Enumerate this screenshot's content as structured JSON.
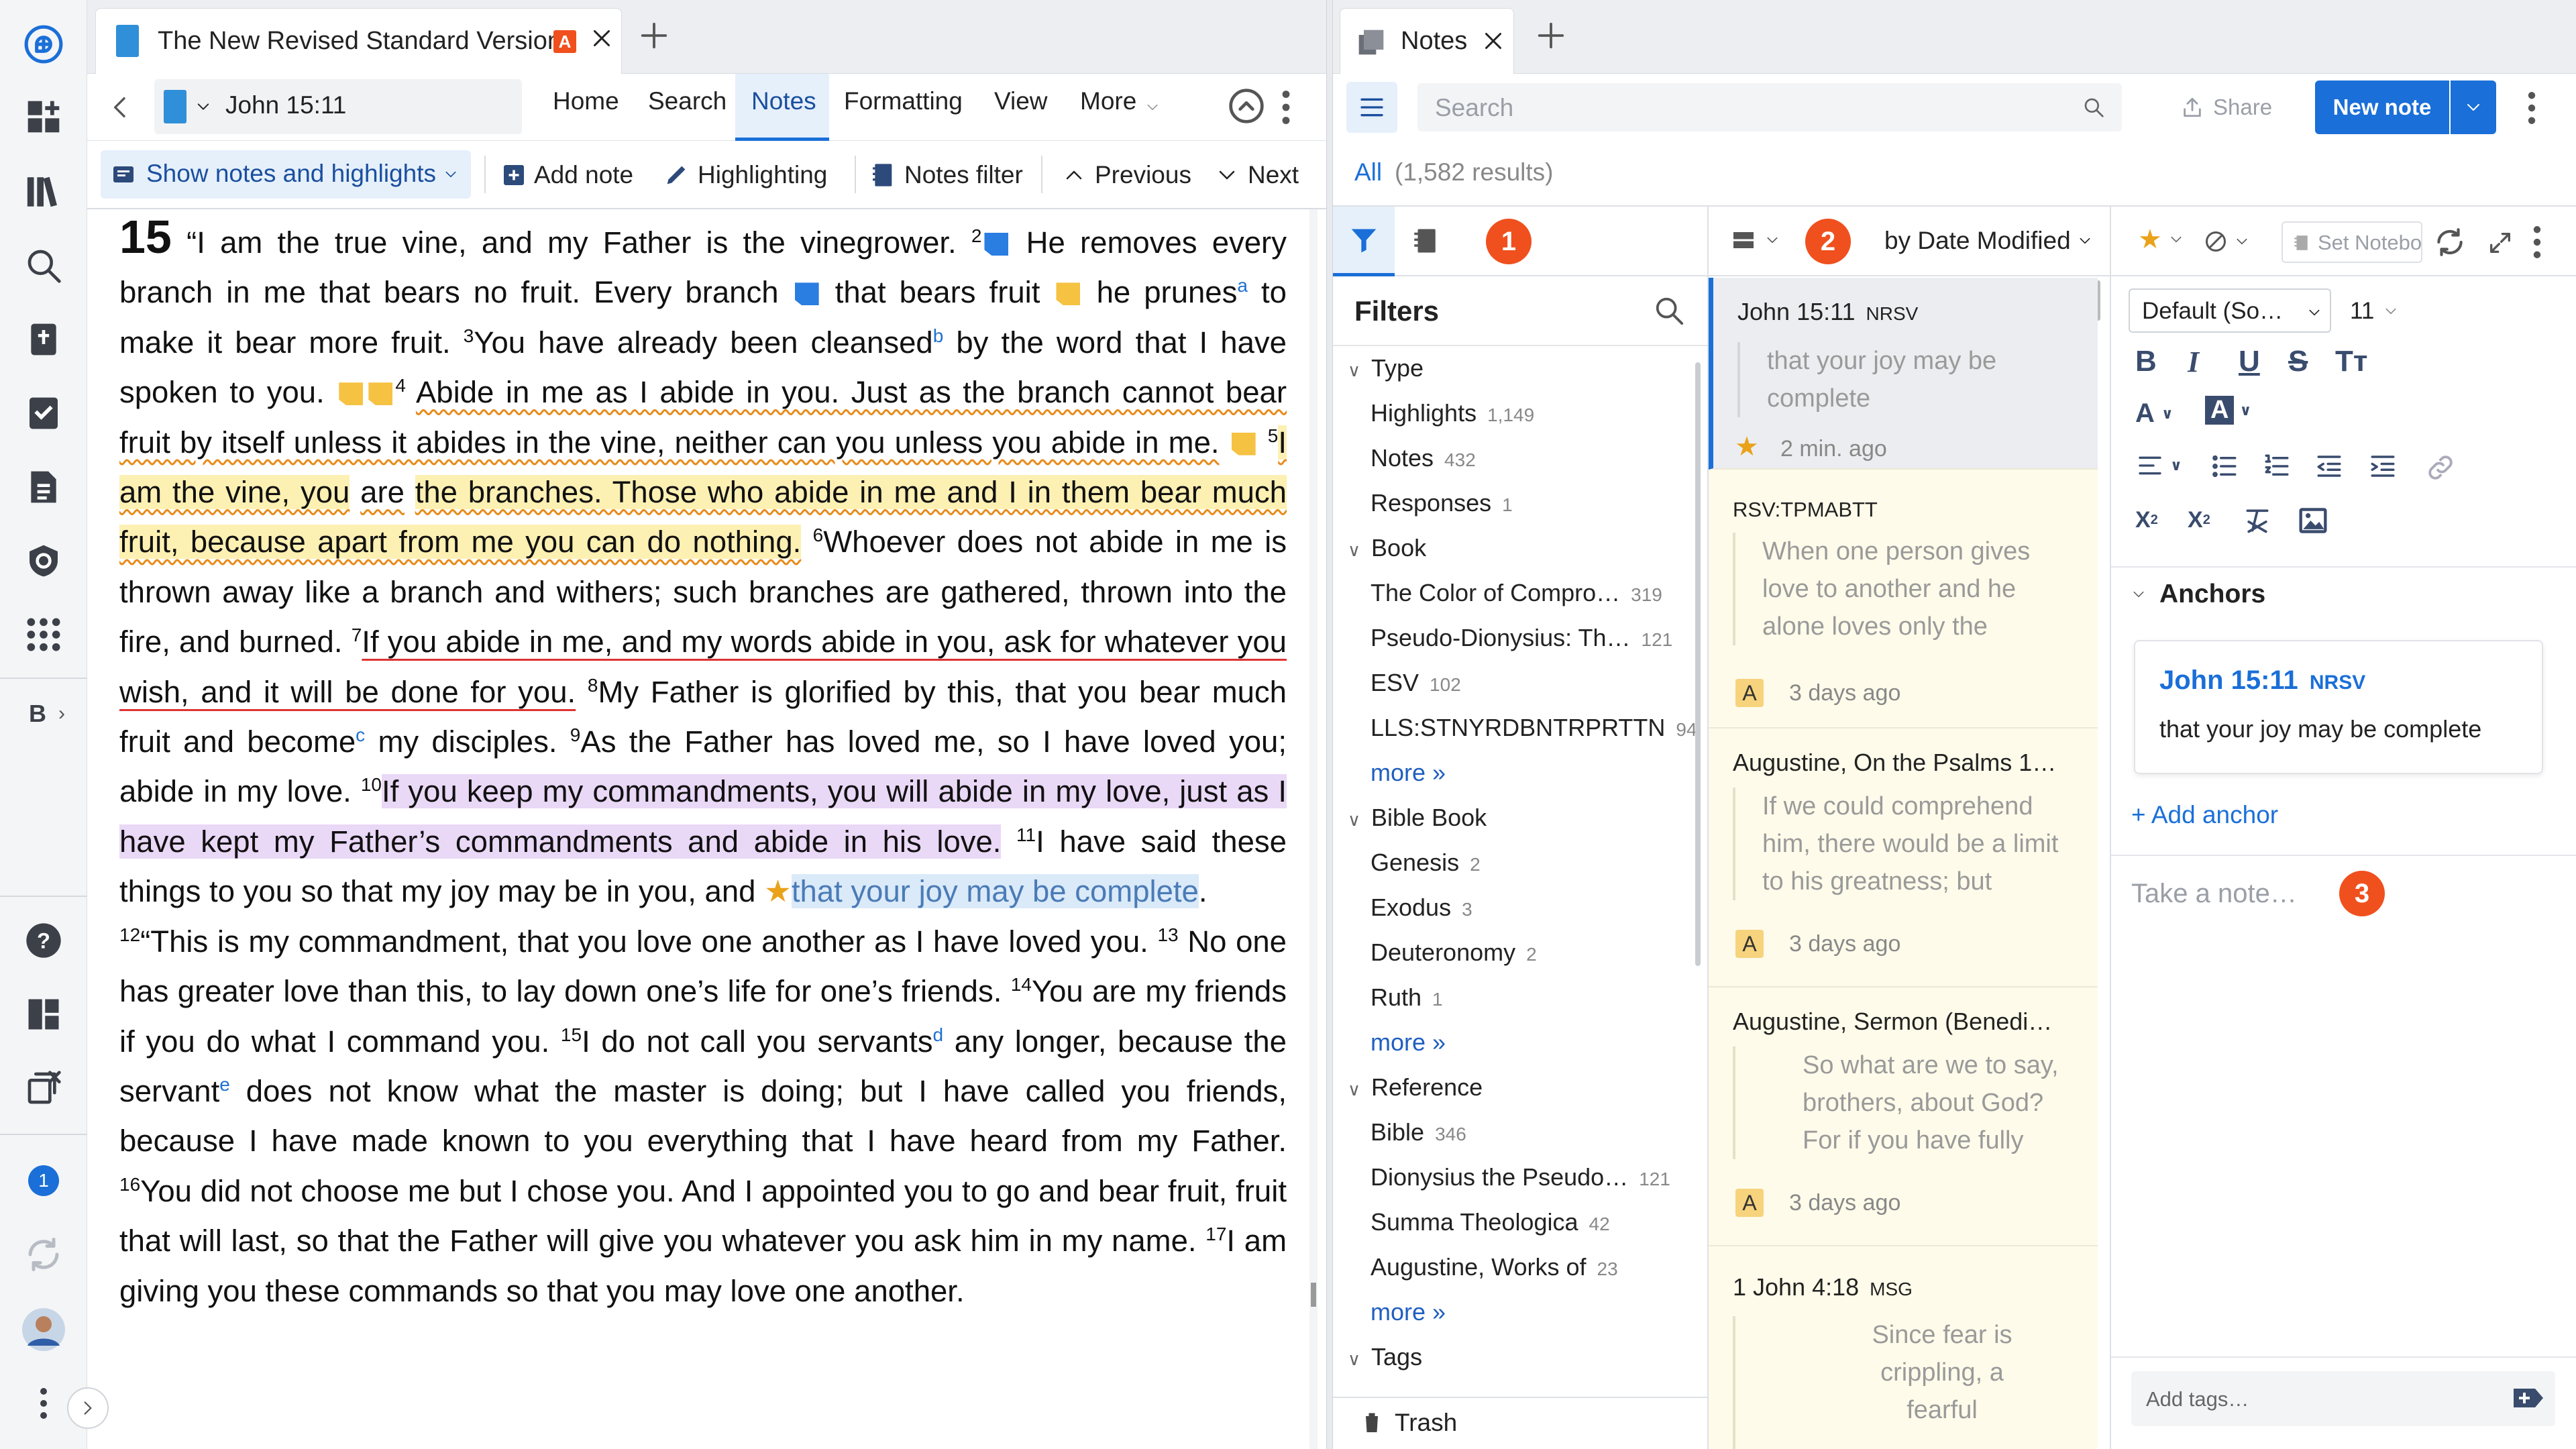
{
  "left_pane": {
    "tab": {
      "title": "The New Revised Standard Version",
      "badge": "A"
    },
    "nav": {
      "reference": "John 15:11",
      "home": "Home",
      "search": "Search",
      "notes": "Notes",
      "formatting": "Formatting",
      "view": "View",
      "more": "More"
    },
    "toolbar": {
      "show_notes": "Show notes and highlights",
      "add_note": "Add note",
      "highlighting": "Highlighting",
      "notes_filter": "Notes filter",
      "previous": "Previous",
      "next": "Next"
    },
    "text": {
      "chapter": "15",
      "v1": "“I am the true vine, and my Father is the vinegrower.",
      "v2n": "2",
      "v2a": "He removes every branch in me that bears no fruit. Every branch",
      "v2b": "that bears fruit",
      "v2c": "he prunes",
      "fn_a": "a",
      "v2d": "to make it bear more fruit.",
      "v3n": "3",
      "v3a": "You have already been cleansed",
      "fn_b": "b",
      "v3b": "by the word that I have spoken to you.",
      "v4n": "4",
      "v4": "Abide in me as I abide in you. Just as the branch cannot bear fruit by itself unless it abides in the vine, neither can you unless you abide in me.",
      "v5n": "5",
      "v5a": "I am the vine, you",
      "v5b": "are",
      "v5c": "the branches. Those who abide in me and I in them bear much fruit, because apart from me you can do nothing.",
      "v6n": "6",
      "v6": "Whoever does not abide in me is thrown away like a branch and withers; such branches are gathered, thrown into the fire, and burned.",
      "v7n": "7",
      "v7": "If you abide in me, and my words abide in you, ask for whatever you wish, and it will be done for you.",
      "v8n": "8",
      "v8a": "My Father is glorified by this, that you bear much fruit and become",
      "fn_c": "c",
      "v8b": "my disciples.",
      "v9n": "9",
      "v9": "As the Father has loved me, so I have loved you; abide in my love.",
      "v10n": "10",
      "v10": "If you keep my commandments, you will abide in my love, just as I have kept my Father’s commandments and abide in his love.",
      "v11n": "11",
      "v11a": "I have said these things to you so that my joy may be in you, and",
      "v11b": "that your joy may be complete",
      "v12n": "12",
      "v12": "“This is my commandment, that you love one another as I have loved you.",
      "v13n": "13",
      "v13": "No one has greater love than this, to lay down one’s life for one’s friends.",
      "v14n": "14",
      "v14": "You are my friends if you do what I command you.",
      "v15n": "15",
      "v15a": "I do not call you servants",
      "fn_d": "d",
      "v15b": "any longer, because the servant",
      "fn_e": "e",
      "v15c": "does not know what the master is doing; but I have called you friends, because I have made known to you everything that I have heard from my Father.",
      "v16n": "16",
      "v16": "You did not choose me but I chose you. And I appointed you to go and bear fruit, fruit that will last, so that the Father will give you whatever you ask him in my name.",
      "v17n": "17",
      "v17": "I am giving you these commands so that you may love one another."
    }
  },
  "right_pane": {
    "tab": {
      "title": "Notes"
    },
    "search_placeholder": "Search",
    "share": "Share",
    "new_note": "New note",
    "results": {
      "all": "All",
      "count": "(1,582 results)"
    },
    "badges": [
      "1",
      "2",
      "3"
    ],
    "filters": {
      "title": "Filters",
      "groups": [
        {
          "label": "Type",
          "items": [
            {
              "name": "Highlights",
              "count": "1,149"
            },
            {
              "name": "Notes",
              "count": "432"
            },
            {
              "name": "Responses",
              "count": "1"
            }
          ]
        },
        {
          "label": "Book",
          "items": [
            {
              "name": "The Color of Compro…",
              "count": "319"
            },
            {
              "name": "Pseudo-Dionysius: Th…",
              "count": "121"
            },
            {
              "name": "ESV",
              "count": "102"
            },
            {
              "name": "LLS:STNYRDBNTRPRTTN",
              "count": "94"
            }
          ],
          "more": "more »"
        },
        {
          "label": "Bible Book",
          "items": [
            {
              "name": "Genesis",
              "count": "2"
            },
            {
              "name": "Exodus",
              "count": "3"
            },
            {
              "name": "Deuteronomy",
              "count": "2"
            },
            {
              "name": "Ruth",
              "count": "1"
            }
          ],
          "more": "more »"
        },
        {
          "label": "Reference",
          "items": [
            {
              "name": "Bible",
              "count": "346"
            },
            {
              "name": "Dionysius the Pseudo…",
              "count": "121"
            },
            {
              "name": "Summa Theologica",
              "count": "42"
            },
            {
              "name": "Augustine, Works of",
              "count": "23"
            }
          ],
          "more": "more »"
        },
        {
          "label": "Tags",
          "items": []
        }
      ],
      "trash": "Trash"
    },
    "list": {
      "sort": "by Date Modified",
      "cards": [
        {
          "title": "John 15:11",
          "version": "NRSV",
          "excerpt": "that your joy may be complete",
          "time": "2 min. ago",
          "icon": "star"
        },
        {
          "title": "RSV:TPMABTT",
          "version": "",
          "excerpt": "When one person gives love to another and he alone loves only the",
          "time": "3 days ago",
          "icon": "A"
        },
        {
          "title": "Augustine, On the Psalms 1…",
          "version": "",
          "excerpt": "If we could comprehend him, there would be a limit to his greatness; but",
          "time": "3 days ago",
          "icon": "A"
        },
        {
          "title": "Augustine, Sermon (Benedi…",
          "version": "",
          "excerpt": "So what are we to say, brothers, about God? For if you have fully grasped",
          "time": "3 days ago",
          "icon": "A"
        },
        {
          "title": "1 John 4:18",
          "version": "MSG",
          "excerpt": "Since fear is crippling, a fearful",
          "time": "",
          "icon": ""
        }
      ]
    },
    "editor": {
      "set_notebook": "Set Notebo",
      "font": "Default (So…",
      "size": "11",
      "anchors_title": "Anchors",
      "anchor": {
        "ref": "John 15:11",
        "version": "NRSV",
        "text": "that your joy may be complete"
      },
      "add_anchor": "+ Add anchor",
      "placeholder": "Take a note…",
      "tags_placeholder": "Add tags…"
    }
  },
  "rail": {
    "bottom_badge": "1",
    "b_label": "B"
  },
  "colors": {
    "accent": "#1a6fd8",
    "orange_badge": "#f0501e",
    "highlight_yellow": "#fdf0b3",
    "highlight_purple": "#ead8f7",
    "highlight_blue": "#dbeaf8",
    "star": "#e9a21a"
  }
}
